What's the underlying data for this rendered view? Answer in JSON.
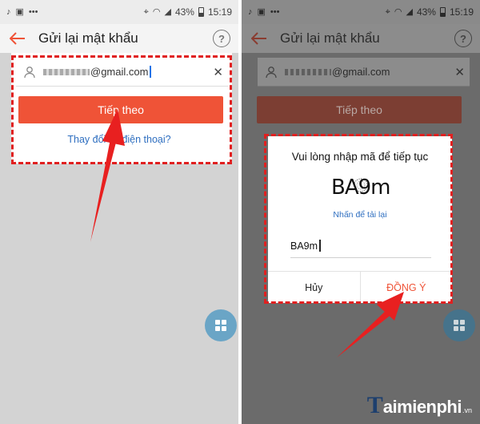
{
  "status_bar": {
    "battery_percent": "43%",
    "time": "15:19"
  },
  "screen": {
    "title": "Gửi lại mật khẩu",
    "email_value": "@gmail.com",
    "next_button": "Tiếp theo",
    "phone_link": "Thay đổi số điện thoại?"
  },
  "captcha_dialog": {
    "title": "Vui lòng nhập mã để tiếp tục",
    "captcha_image_text": "BA9m",
    "reload_link": "Nhấn để tải lại",
    "input_value": "BA9m",
    "cancel_label": "Hủy",
    "confirm_label": "ĐỒNG Ý"
  },
  "watermark": {
    "brand": "aimienphi",
    "suffix": ".vn"
  },
  "colors": {
    "accent": "#ef5337",
    "annotation_red": "#e02020",
    "link_blue": "#2f6fc0",
    "fab": "#6aa5c6"
  },
  "icons": [
    "back-arrow-icon",
    "help-icon",
    "user-icon",
    "clear-icon",
    "apps-grid-icon",
    "tiktok-icon",
    "signal-icon",
    "wifi-icon",
    "battery-icon"
  ]
}
